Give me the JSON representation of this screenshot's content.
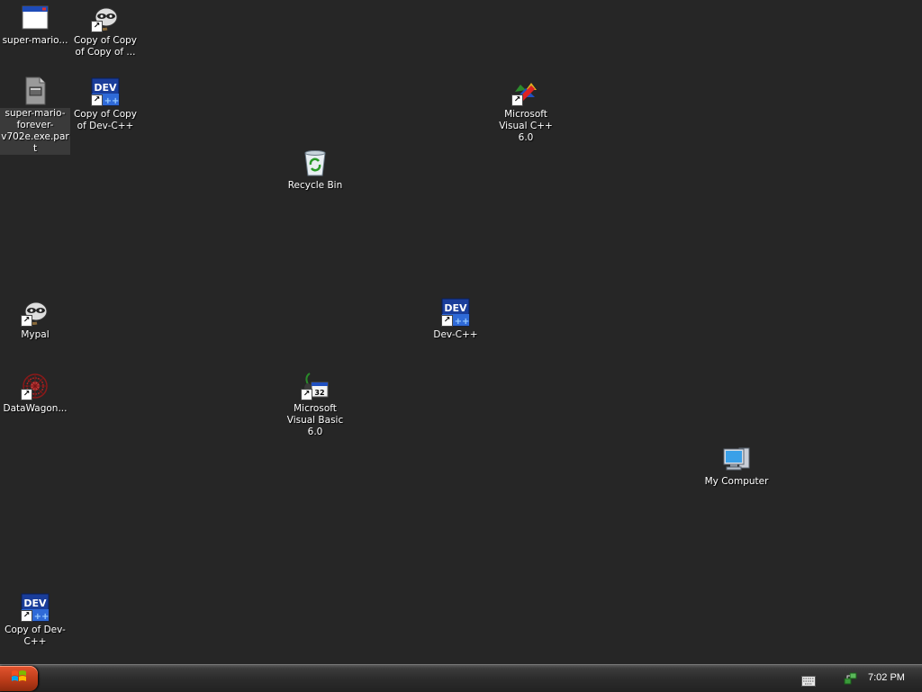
{
  "desktop": {
    "icons": [
      {
        "label": "super-mario...",
        "icon": "application-window-icon"
      },
      {
        "label": "Copy of Copy of Copy of ...",
        "icon": "mypal-raccoon-icon"
      },
      {
        "label": "super-mario-forever-v702e.exe.part",
        "icon": "partial-download-file-icon"
      },
      {
        "label": "Copy of Copy of Dev-C++",
        "icon": "dev-cpp-icon"
      },
      {
        "label": "Microsoft Visual C++ 6.0",
        "icon": "visual-cpp-icon"
      },
      {
        "label": "Recycle Bin",
        "icon": "recycle-bin-icon"
      },
      {
        "label": "Mypal",
        "icon": "mypal-raccoon-icon"
      },
      {
        "label": "Dev-C++",
        "icon": "dev-cpp-icon"
      },
      {
        "label": "DataWagon...",
        "icon": "datawagon-icon"
      },
      {
        "label": "Microsoft Visual Basic 6.0",
        "icon": "visual-basic-icon"
      },
      {
        "label": "My Computer",
        "icon": "my-computer-icon"
      },
      {
        "label": "Copy of Dev-C++",
        "icon": "dev-cpp-icon"
      }
    ],
    "dev_text": "DEV",
    "shortcut_arrow": "↗"
  },
  "taskbar": {
    "start_icon": "windows-logo-icon",
    "tray": {
      "keyboard_icon": "keyboard-icon",
      "network_icon": "network-icon",
      "clock": "7:02 PM"
    }
  },
  "colors": {
    "desktop_background": "#262626",
    "start_button": "#c8421e",
    "taskbar": "#2c2c2c"
  }
}
